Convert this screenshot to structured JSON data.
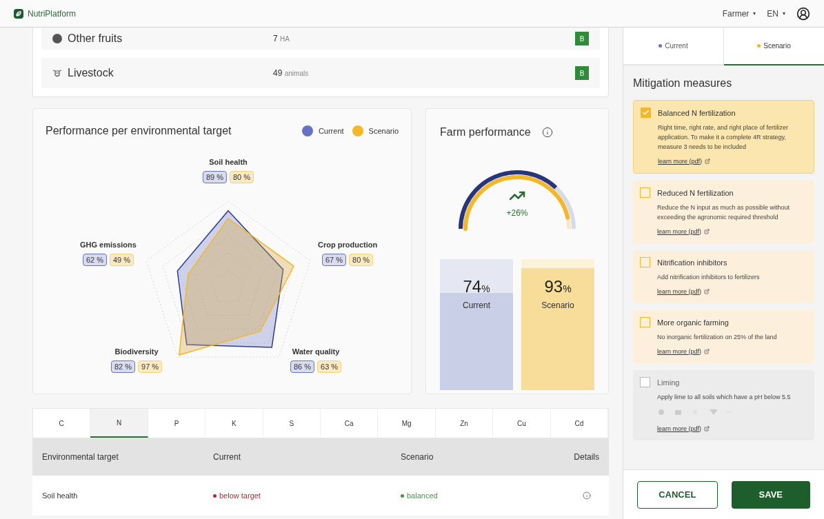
{
  "header": {
    "brand": "NutriPlatform",
    "menus": [
      {
        "label": "Farmer",
        "caret": "▾"
      },
      {
        "label": "EN",
        "caret": "▾"
      }
    ]
  },
  "land_use": [
    {
      "kind": "dot",
      "name": "Other fruits",
      "amount": "7",
      "unit": "HA",
      "grade": "B"
    },
    {
      "kind": "livestock",
      "name": "Livestock",
      "amount": "49",
      "unit": "animals",
      "grade": "B"
    }
  ],
  "radar": {
    "title": "Performance per environmental target",
    "legend": [
      {
        "label": "Current",
        "color": "#6673c4"
      },
      {
        "label": "Scenario",
        "color": "#f4b728"
      }
    ],
    "axes": [
      {
        "label": "Soil health",
        "current": "89 %",
        "scenario": "80 %"
      },
      {
        "label": "GHG emissions",
        "current": "62 %",
        "scenario": "49 %"
      },
      {
        "label": "Crop production",
        "current": "67 %",
        "scenario": "80 %"
      },
      {
        "label": "Biodiversity",
        "current": "82 %",
        "scenario": "97 %"
      },
      {
        "label": "Water quality",
        "current": "86 %",
        "scenario": "63 %"
      }
    ]
  },
  "farm_performance": {
    "title": "Farm performance",
    "change": "+26%",
    "bars": [
      {
        "value": "74",
        "unit": "%",
        "label": "Current"
      },
      {
        "value": "93",
        "unit": "%",
        "label": "Scenario"
      }
    ]
  },
  "nutrient_tabs": [
    {
      "label": "C",
      "selected": false
    },
    {
      "label": "N",
      "selected": true
    },
    {
      "label": "P",
      "selected": false
    },
    {
      "label": "K",
      "selected": false
    },
    {
      "label": "S",
      "selected": false
    },
    {
      "label": "Ca",
      "selected": false
    },
    {
      "label": "Mg",
      "selected": false
    },
    {
      "label": "Zn",
      "selected": false
    },
    {
      "label": "Cu",
      "selected": false
    },
    {
      "label": "Cd",
      "selected": false
    }
  ],
  "table": {
    "columns": [
      "Environmental target",
      "Current",
      "Scenario",
      "Details"
    ],
    "rows": [
      {
        "target": "Soil health",
        "current": {
          "text": "below target",
          "color": "#b3262e"
        },
        "scenario": {
          "text": "balanced",
          "color": "#3f9a3f"
        }
      }
    ]
  },
  "panel": {
    "tabs": [
      {
        "label": "Current",
        "color": "#6673c4",
        "selected": false
      },
      {
        "label": "Scenario",
        "color": "#f4b728",
        "selected": true
      }
    ],
    "title": "Mitigation measures",
    "measures": [
      {
        "kind": "plain",
        "title": "Balanced N fertilization",
        "description": "Right time, right rate, and right place of fertilizer application. To make it a complete 4R strategy, measure 3 needs to be included",
        "link": "learn more (pdf)",
        "checked": true,
        "disabled": false
      },
      {
        "kind": "plain",
        "title": "Reduced N fertilization",
        "description": "Reduce the N input as much as possible without exceeding the agronomic required threshold",
        "link": "learn more (pdf)",
        "checked": false,
        "disabled": false
      },
      {
        "kind": "plain",
        "title": "Nitrification inhibitors",
        "description": "Add nitrification inhibitors to fertilizers",
        "link": "learn more (pdf)",
        "checked": false,
        "disabled": false
      },
      {
        "kind": "plain",
        "title": "More organic farming",
        "description": "No inorganic fertilization on 25% of the land",
        "link": "learn more (pdf)",
        "checked": false,
        "disabled": false
      },
      {
        "kind": "with-impacts",
        "title": "Liming",
        "description": "Apply lime to all soils which have a pH below 5.5",
        "link": "learn more (pdf)",
        "checked": false,
        "disabled": true
      }
    ],
    "buttons": [
      {
        "kind": "secondary",
        "label": "CANCEL"
      },
      {
        "kind": "primary",
        "label": "SAVE"
      }
    ]
  }
}
